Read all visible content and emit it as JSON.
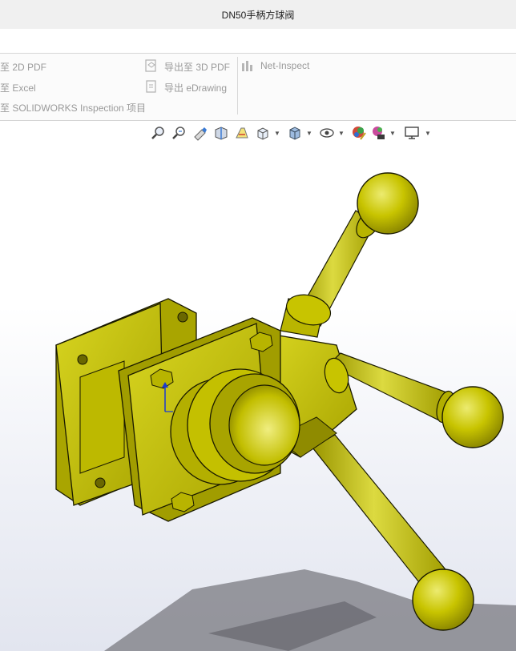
{
  "window": {
    "title": "DN50手柄方球阀"
  },
  "ribbon": {
    "left_items": [
      {
        "label": "至 2D PDF"
      },
      {
        "label": "至 Excel"
      },
      {
        "label": "至 SOLIDWORKS Inspection 项目"
      }
    ],
    "middle_items": [
      {
        "label": "导出至 3D PDF"
      },
      {
        "label": "导出 eDrawing"
      }
    ],
    "right_items": [
      {
        "label": "Net-Inspect"
      }
    ]
  },
  "view_toolbar": {
    "icons": [
      "zoom-to-fit-icon",
      "zoom-to-area-icon",
      "previous-view-icon",
      "section-view-icon",
      "dynamic-annotation-icon",
      "view-orientation-icon",
      "display-style-icon",
      "hide-show-items-icon",
      "edit-appearance-icon",
      "apply-scene-icon",
      "view-settings-icon"
    ]
  },
  "colors": {
    "model_body": "#c8c400",
    "model_shade": "#8f8b00",
    "model_highlight": "#eae86a",
    "edge": "#1a1a00",
    "shadow": "#7a7a80"
  }
}
